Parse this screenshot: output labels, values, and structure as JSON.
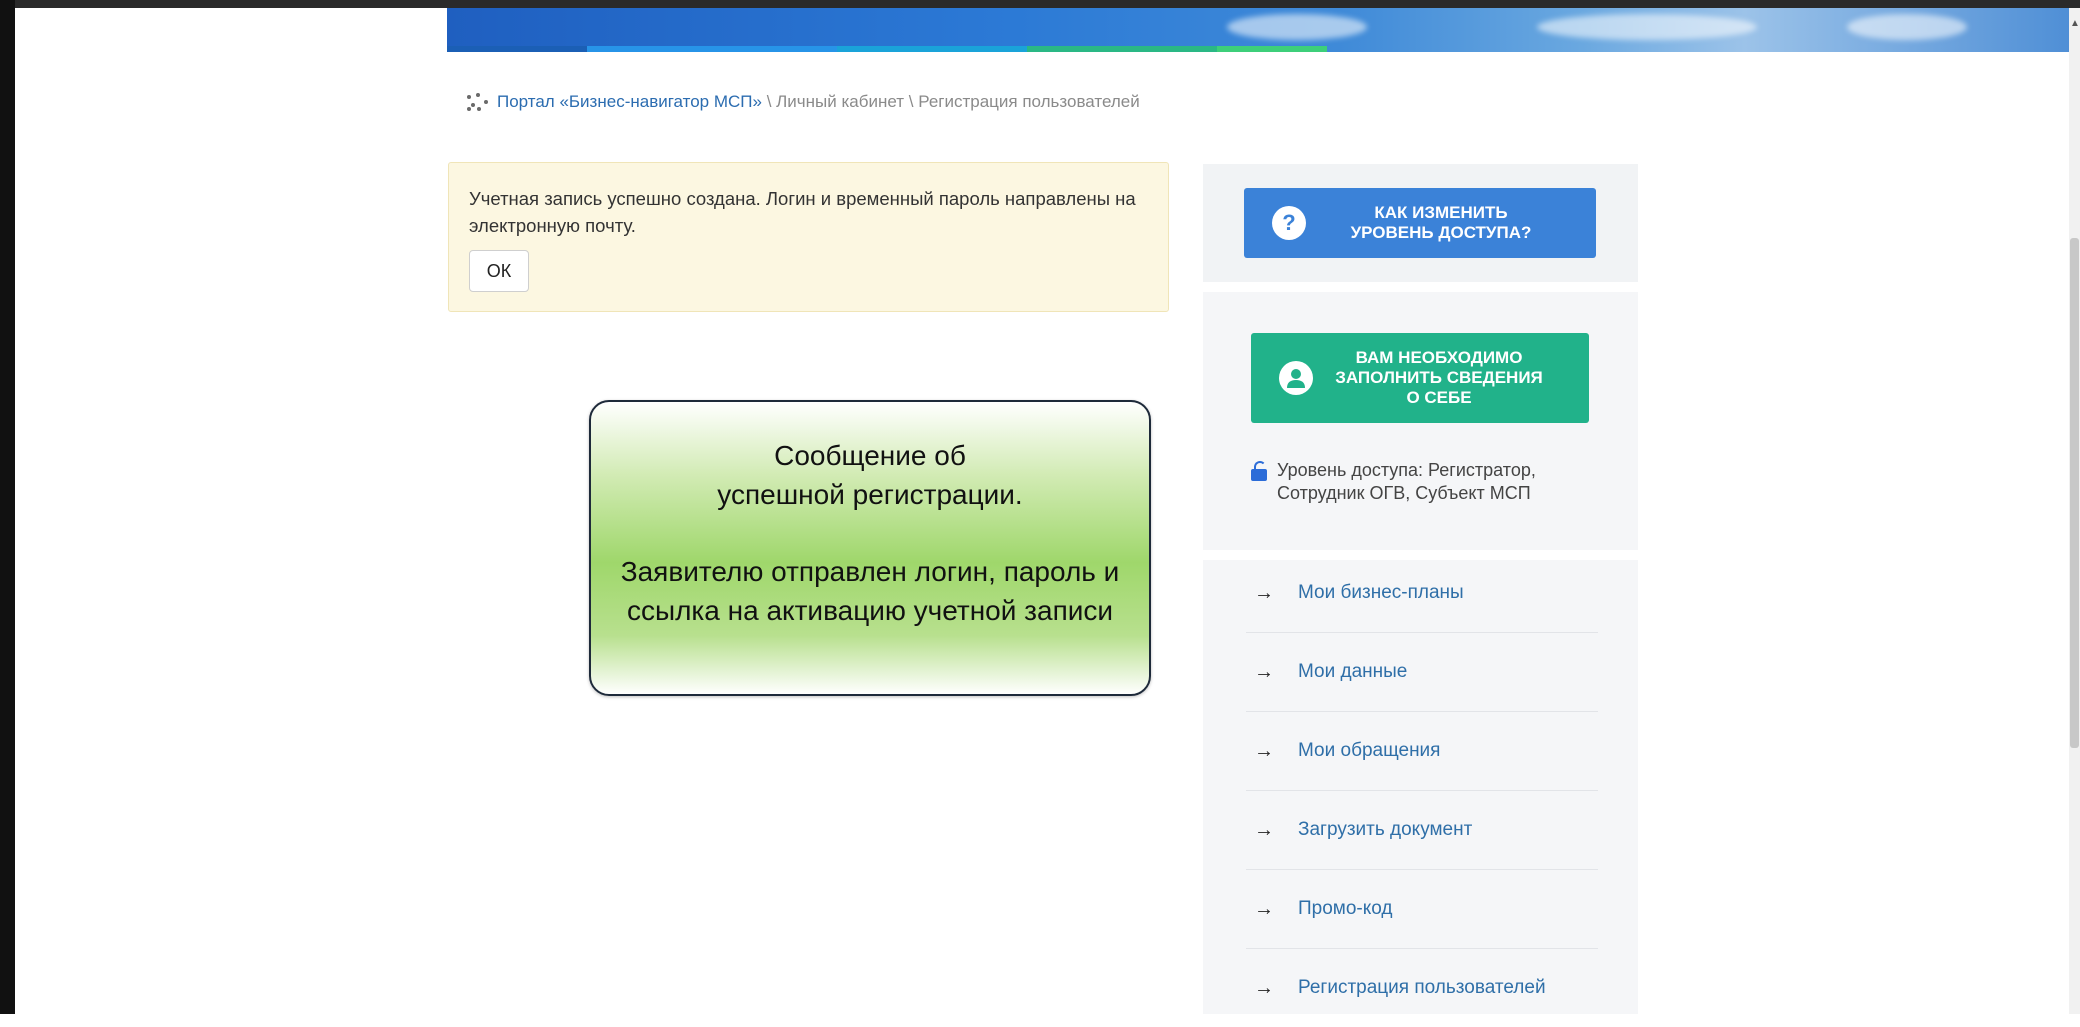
{
  "breadcrumb": {
    "home_link": "Портал «Бизнес-навигатор МСП»",
    "rest": " \\ Личный кабинет \\ Регистрация пользователей"
  },
  "alert": {
    "message": "Учетная запись успешно создана. Логин и временный пароль направлены на электронную почту.",
    "ok_label": "ОК",
    "bg_color": "#fcf7e1"
  },
  "callout": {
    "line1": "Сообщение об успешной регистрации.",
    "line2": "Заявителю отправлен логин, пароль и ссылка на активацию учетной записи"
  },
  "sidebar": {
    "access_button": {
      "label": "КАК ИЗМЕНИТЬ УРОВЕНЬ ДОСТУПА?",
      "icon": "question-icon",
      "color": "#3b82d8"
    },
    "profile_button": {
      "label": "ВАМ НЕОБХОДИМО ЗАПОЛНИТЬ СВЕДЕНИЯ О СЕБЕ",
      "icon": "user-icon",
      "color": "#21b28a"
    },
    "access_level": "Уровень доступа: Регистратор, Сотрудник ОГВ, Субъект МСП",
    "menu": [
      {
        "label": "Мои бизнес-планы"
      },
      {
        "label": "Мои данные"
      },
      {
        "label": "Мои обращения"
      },
      {
        "label": "Загрузить документ"
      },
      {
        "label": "Промо-код"
      },
      {
        "label": "Регистрация пользователей"
      }
    ]
  }
}
